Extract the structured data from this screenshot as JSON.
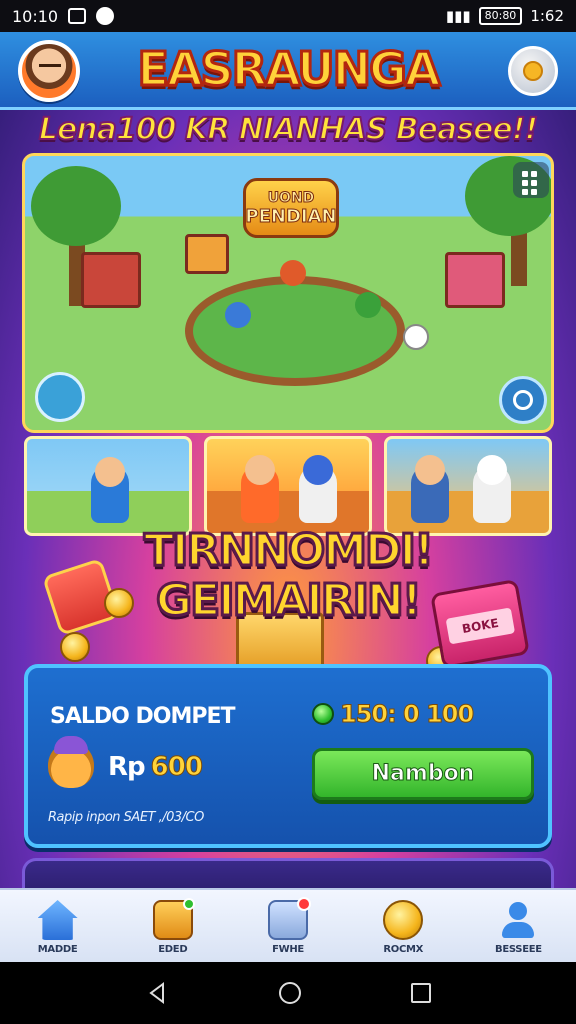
{
  "status_bar": {
    "time": "10:10",
    "battery": "80:80",
    "clock_right": "1:62"
  },
  "header": {
    "title": "EASRAUNGA",
    "subtitle": "Lena100 KR NIANHAS Beasee!!"
  },
  "scene": {
    "badge_line1": "UOND",
    "badge_line2": "PENDIAN"
  },
  "promo": {
    "line1": "TIRNNOMDI!",
    "line2": "GEIMAIRIN!",
    "gift_label": "BOKE"
  },
  "wallet": {
    "title": "SALDO DOMPET",
    "points": "150: 0 100",
    "balance_prefix": "Rp",
    "balance": "600",
    "button_label": "Nambon",
    "footnote": "Rapip inpon SAET ,/03/CO"
  },
  "bottom_nav": {
    "items": [
      {
        "label": "MADDE",
        "icon": "home-icon"
      },
      {
        "label": "EDED",
        "icon": "inventory-box-icon"
      },
      {
        "label": "FWHE",
        "icon": "mail-icon"
      },
      {
        "label": "ROCMX",
        "icon": "coin-icon"
      },
      {
        "label": "BESSEEE",
        "icon": "profile-icon"
      }
    ]
  },
  "colors": {
    "header_blue": "#1c5fbf",
    "title_yellow": "#ffd23a",
    "button_green": "#33b52b",
    "panel_blue": "#1552ad"
  }
}
